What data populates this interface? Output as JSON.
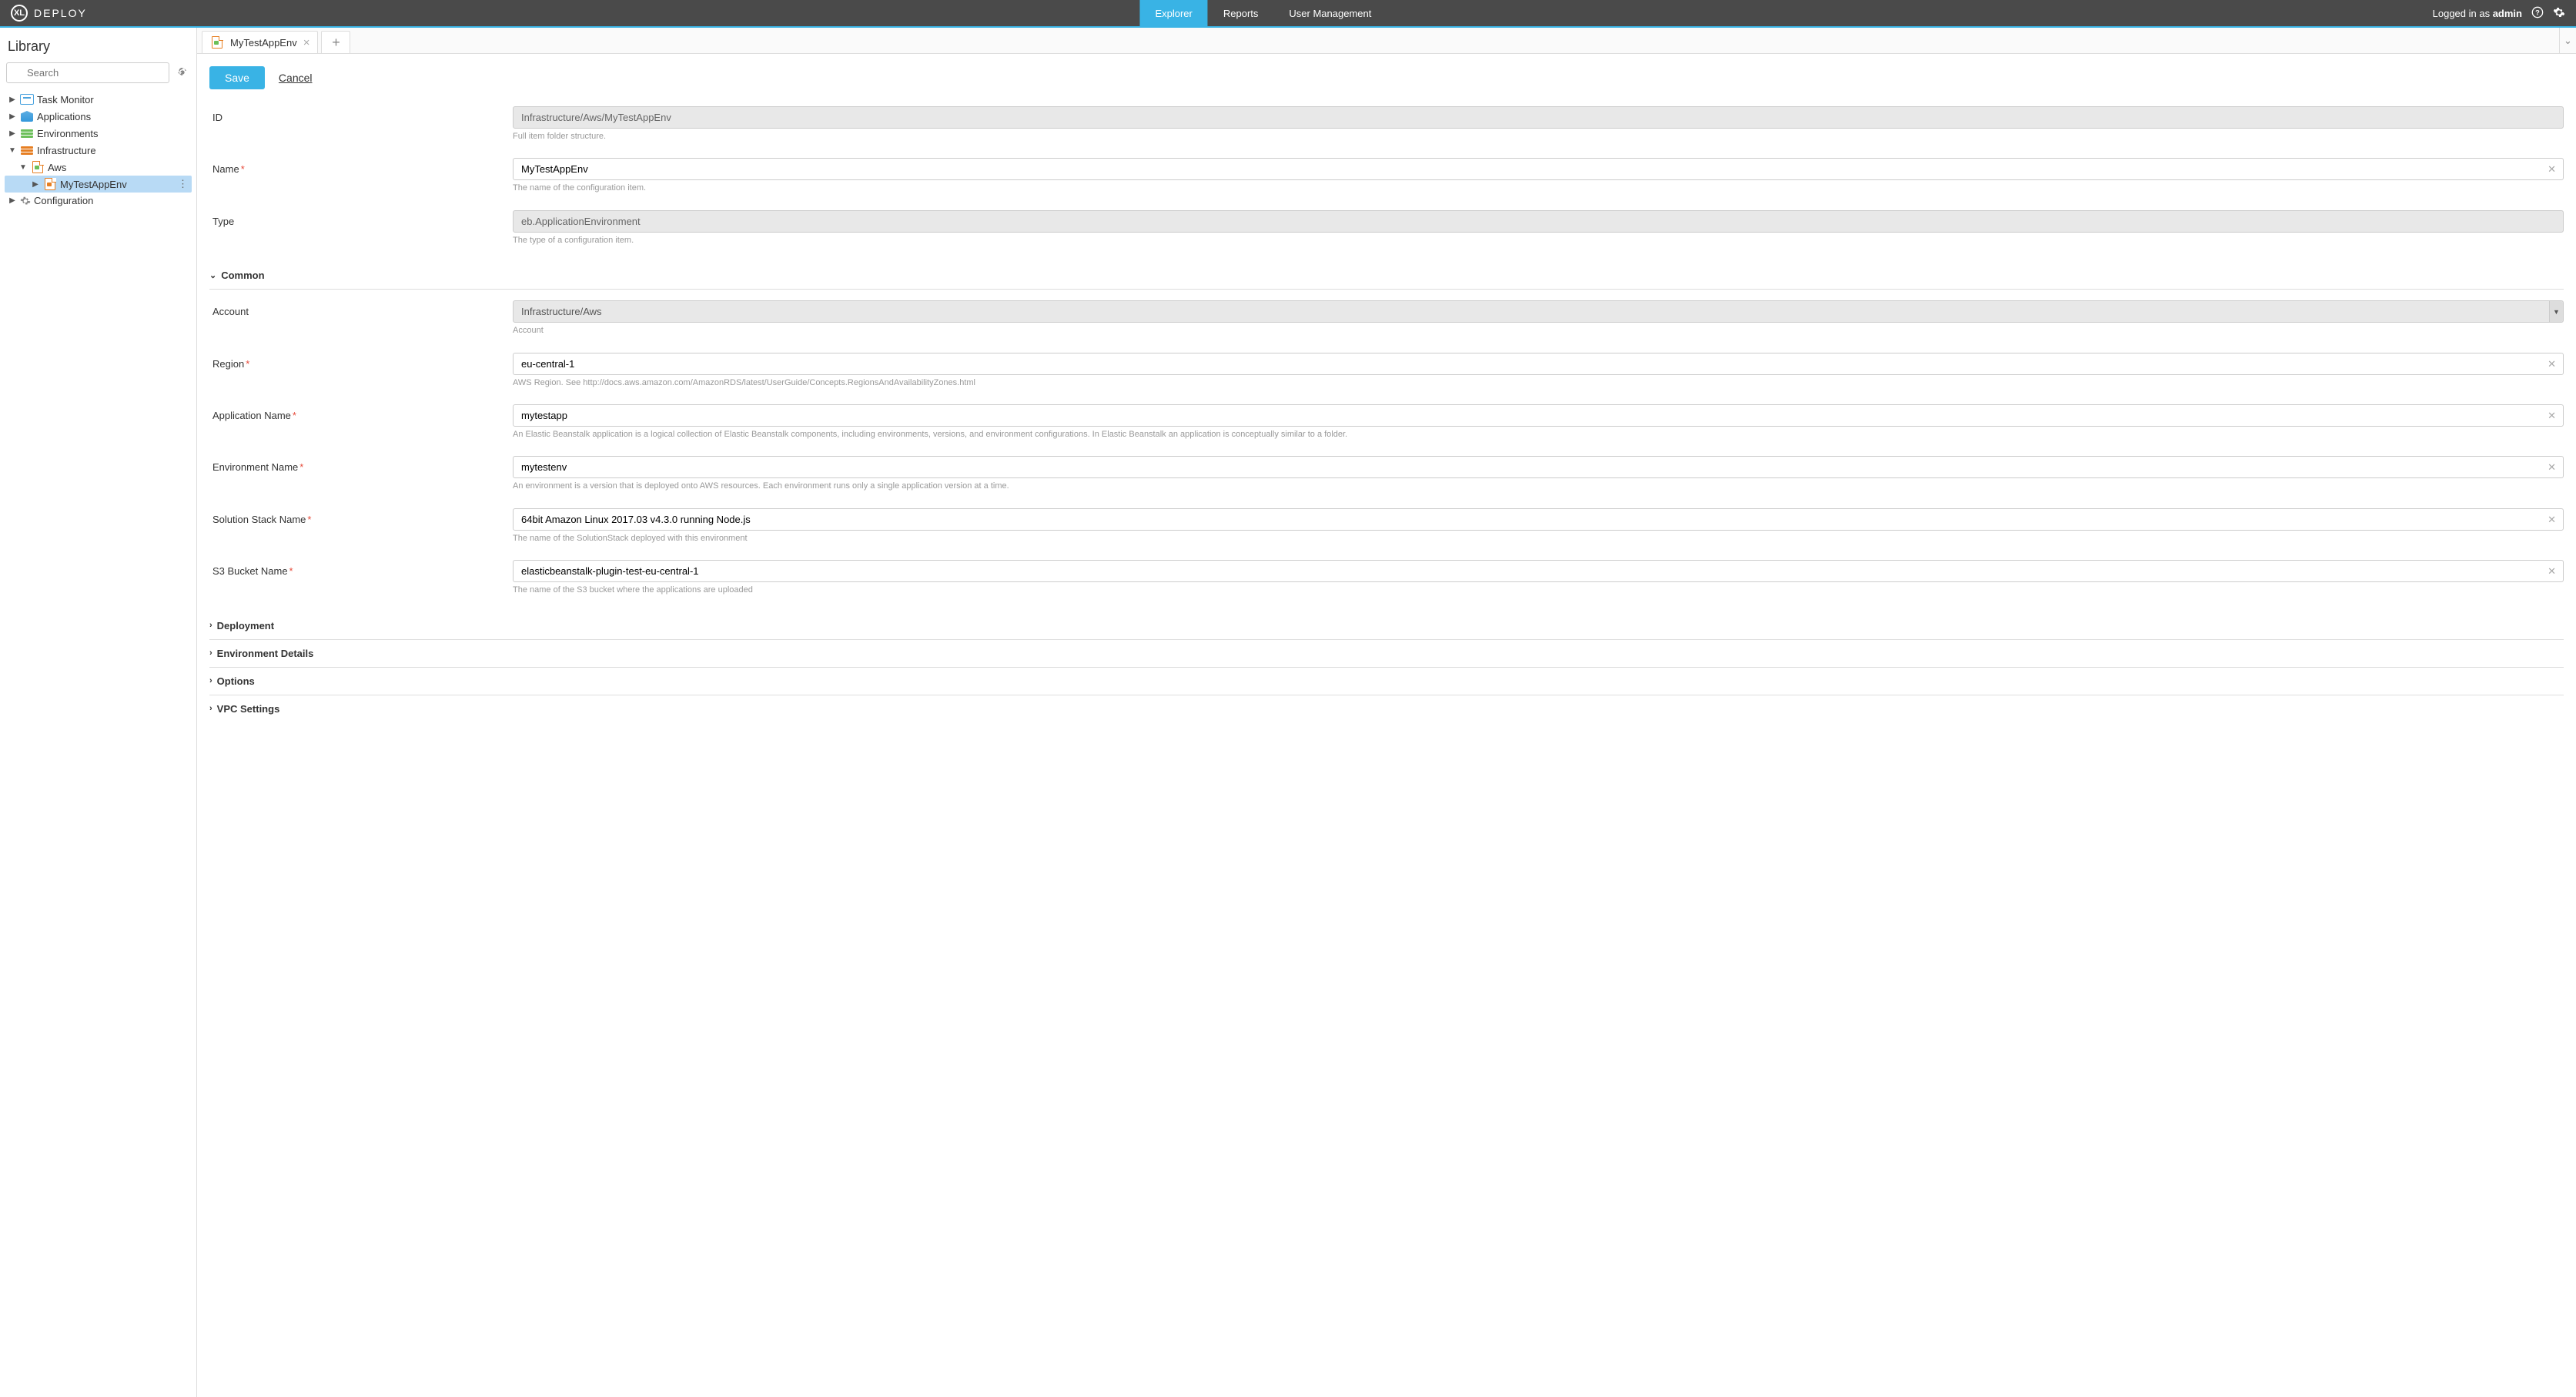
{
  "header": {
    "product": "DEPLOY",
    "logo_letters": "XL",
    "nav": [
      {
        "label": "Explorer",
        "active": true
      },
      {
        "label": "Reports",
        "active": false
      },
      {
        "label": "User Management",
        "active": false
      }
    ],
    "logged_in_prefix": "Logged in as ",
    "username": "admin"
  },
  "sidebar": {
    "title": "Library",
    "search_placeholder": "Search",
    "tree": {
      "task_monitor": "Task Monitor",
      "applications": "Applications",
      "environments": "Environments",
      "infrastructure": "Infrastructure",
      "aws": "Aws",
      "mytestappenv": "MyTestAppEnv",
      "configuration": "Configuration"
    }
  },
  "tabs": {
    "current": "MyTestAppEnv"
  },
  "actions": {
    "save": "Save",
    "cancel": "Cancel"
  },
  "form": {
    "id": {
      "label": "ID",
      "value": "Infrastructure/Aws/MyTestAppEnv",
      "help": "Full item folder structure."
    },
    "name": {
      "label": "Name",
      "value": "MyTestAppEnv",
      "help": "The name of the configuration item."
    },
    "type": {
      "label": "Type",
      "value": "eb.ApplicationEnvironment",
      "help": "The type of a configuration item."
    },
    "account": {
      "label": "Account",
      "value": "Infrastructure/Aws",
      "help": "Account"
    },
    "region": {
      "label": "Region",
      "value": "eu-central-1",
      "help": "AWS Region. See http://docs.aws.amazon.com/AmazonRDS/latest/UserGuide/Concepts.RegionsAndAvailabilityZones.html"
    },
    "app_name": {
      "label": "Application Name",
      "value": "mytestapp",
      "help": "An Elastic Beanstalk application is a logical collection of Elastic Beanstalk components, including environments, versions, and environment configurations. In Elastic Beanstalk an application is conceptually similar to a folder."
    },
    "env_name": {
      "label": "Environment Name",
      "value": "mytestenv",
      "help": "An environment is a version that is deployed onto AWS resources. Each environment runs only a single application version at a time."
    },
    "stack_name": {
      "label": "Solution Stack Name",
      "value": "64bit Amazon Linux 2017.03 v4.3.0 running Node.js",
      "help": "The name of the SolutionStack deployed with this environment"
    },
    "bucket": {
      "label": "S3 Bucket Name",
      "value": "elasticbeanstalk-plugin-test-eu-central-1",
      "help": "The name of the S3 bucket where the applications are uploaded"
    }
  },
  "sections": {
    "common": "Common",
    "deployment": "Deployment",
    "env_details": "Environment Details",
    "options": "Options",
    "vpc": "VPC Settings"
  }
}
